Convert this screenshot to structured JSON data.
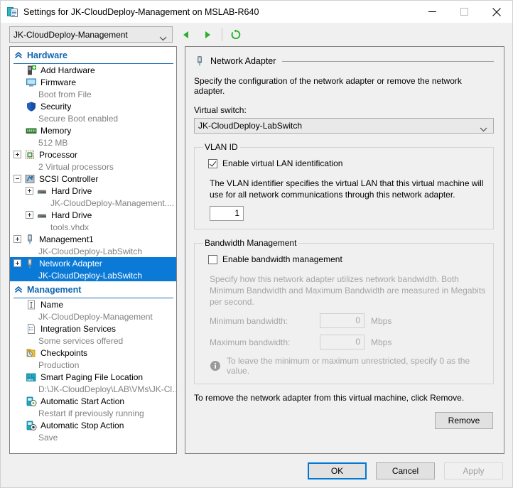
{
  "window": {
    "title": "Settings for JK-CloudDeploy-Management on MSLAB-R640",
    "title_icon": "settings-vm-icon",
    "minimize_label": "Minimize",
    "maximize_label": "Maximize",
    "close_label": "Close"
  },
  "toolbar": {
    "vm_selected": "JK-CloudDeploy-Management",
    "back_label": "Back",
    "forward_label": "Forward",
    "refresh_label": "Refresh"
  },
  "tree": {
    "groups": [
      {
        "label": "Hardware",
        "items": [
          {
            "label": "Add Hardware",
            "sub": "",
            "icon": "add-hardware-icon",
            "expander": "none",
            "indent": 1,
            "selected": false
          },
          {
            "label": "Firmware",
            "sub": "Boot from File",
            "icon": "firmware-icon",
            "expander": "none",
            "indent": 1,
            "selected": false
          },
          {
            "label": "Security",
            "sub": "Secure Boot enabled",
            "icon": "security-shield-icon",
            "expander": "none",
            "indent": 1,
            "selected": false
          },
          {
            "label": "Memory",
            "sub": "512 MB",
            "icon": "memory-icon",
            "expander": "none",
            "indent": 1,
            "selected": false
          },
          {
            "label": "Processor",
            "sub": "2 Virtual processors",
            "icon": "processor-icon",
            "expander": "plus",
            "indent": 0,
            "selected": false
          },
          {
            "label": "SCSI Controller",
            "sub": "",
            "icon": "scsi-controller-icon",
            "expander": "minus",
            "indent": 0,
            "selected": false
          },
          {
            "label": "Hard Drive",
            "sub": "JK-CloudDeploy-Management....",
            "icon": "hard-drive-icon",
            "expander": "plus",
            "indent": 1,
            "selected": false
          },
          {
            "label": "Hard Drive",
            "sub": "tools.vhdx",
            "icon": "hard-drive-icon",
            "expander": "plus",
            "indent": 1,
            "selected": false
          },
          {
            "label": "Management1",
            "sub": "JK-CloudDeploy-LabSwitch",
            "icon": "network-adapter-icon",
            "expander": "plus",
            "indent": 0,
            "selected": false
          },
          {
            "label": "Network Adapter",
            "sub": "JK-CloudDeploy-LabSwitch",
            "icon": "network-adapter-icon",
            "expander": "plus",
            "indent": 0,
            "selected": true
          }
        ]
      },
      {
        "label": "Management",
        "items": [
          {
            "label": "Name",
            "sub": "JK-CloudDeploy-Management",
            "icon": "name-icon",
            "expander": "none",
            "indent": 1,
            "selected": false
          },
          {
            "label": "Integration Services",
            "sub": "Some services offered",
            "icon": "integration-services-icon",
            "expander": "none",
            "indent": 1,
            "selected": false
          },
          {
            "label": "Checkpoints",
            "sub": "Production",
            "icon": "checkpoints-icon",
            "expander": "none",
            "indent": 1,
            "selected": false
          },
          {
            "label": "Smart Paging File Location",
            "sub": "D:\\JK-CloudDeploy\\LAB\\VMs\\JK-Cl…",
            "icon": "smart-paging-icon",
            "expander": "none",
            "indent": 1,
            "selected": false
          },
          {
            "label": "Automatic Start Action",
            "sub": "Restart if previously running",
            "icon": "auto-start-icon",
            "expander": "none",
            "indent": 1,
            "selected": false
          },
          {
            "label": "Automatic Stop Action",
            "sub": "Save",
            "icon": "auto-stop-icon",
            "expander": "none",
            "indent": 1,
            "selected": false
          }
        ]
      }
    ]
  },
  "panel": {
    "heading": "Network Adapter",
    "heading_icon": "network-adapter-icon",
    "description": "Specify the configuration of the network adapter or remove the network adapter.",
    "switch_label": "Virtual switch:",
    "switch_value": "JK-CloudDeploy-LabSwitch",
    "vlan": {
      "legend": "VLAN ID",
      "checkbox_label": "Enable virtual LAN identification",
      "checked": true,
      "description": "The VLAN identifier specifies the virtual LAN that this virtual machine will use for all network communications through this network adapter.",
      "value": "1"
    },
    "bandwidth": {
      "legend": "Bandwidth Management",
      "checkbox_label": "Enable bandwidth management",
      "checked": false,
      "description": "Specify how this network adapter utilizes network bandwidth. Both Minimum Bandwidth and Maximum Bandwidth are measured in Megabits per second.",
      "min_label": "Minimum bandwidth:",
      "min_value": "0",
      "min_unit": "Mbps",
      "max_label": "Maximum bandwidth:",
      "max_value": "0",
      "max_unit": "Mbps",
      "info_icon": "info-icon",
      "info_text": "To leave the minimum or maximum unrestricted, specify 0 as the value."
    },
    "remove_text": "To remove the network adapter from this virtual machine, click Remove.",
    "remove_button": "Remove"
  },
  "footer": {
    "ok": "OK",
    "cancel": "Cancel",
    "apply": "Apply",
    "apply_disabled": true
  },
  "colors": {
    "accent": "#0078d7",
    "selection": "#0b7ad6",
    "group_header": "#1166b0",
    "disabled_text": "#a6a6a6",
    "sub_text": "#808080"
  }
}
